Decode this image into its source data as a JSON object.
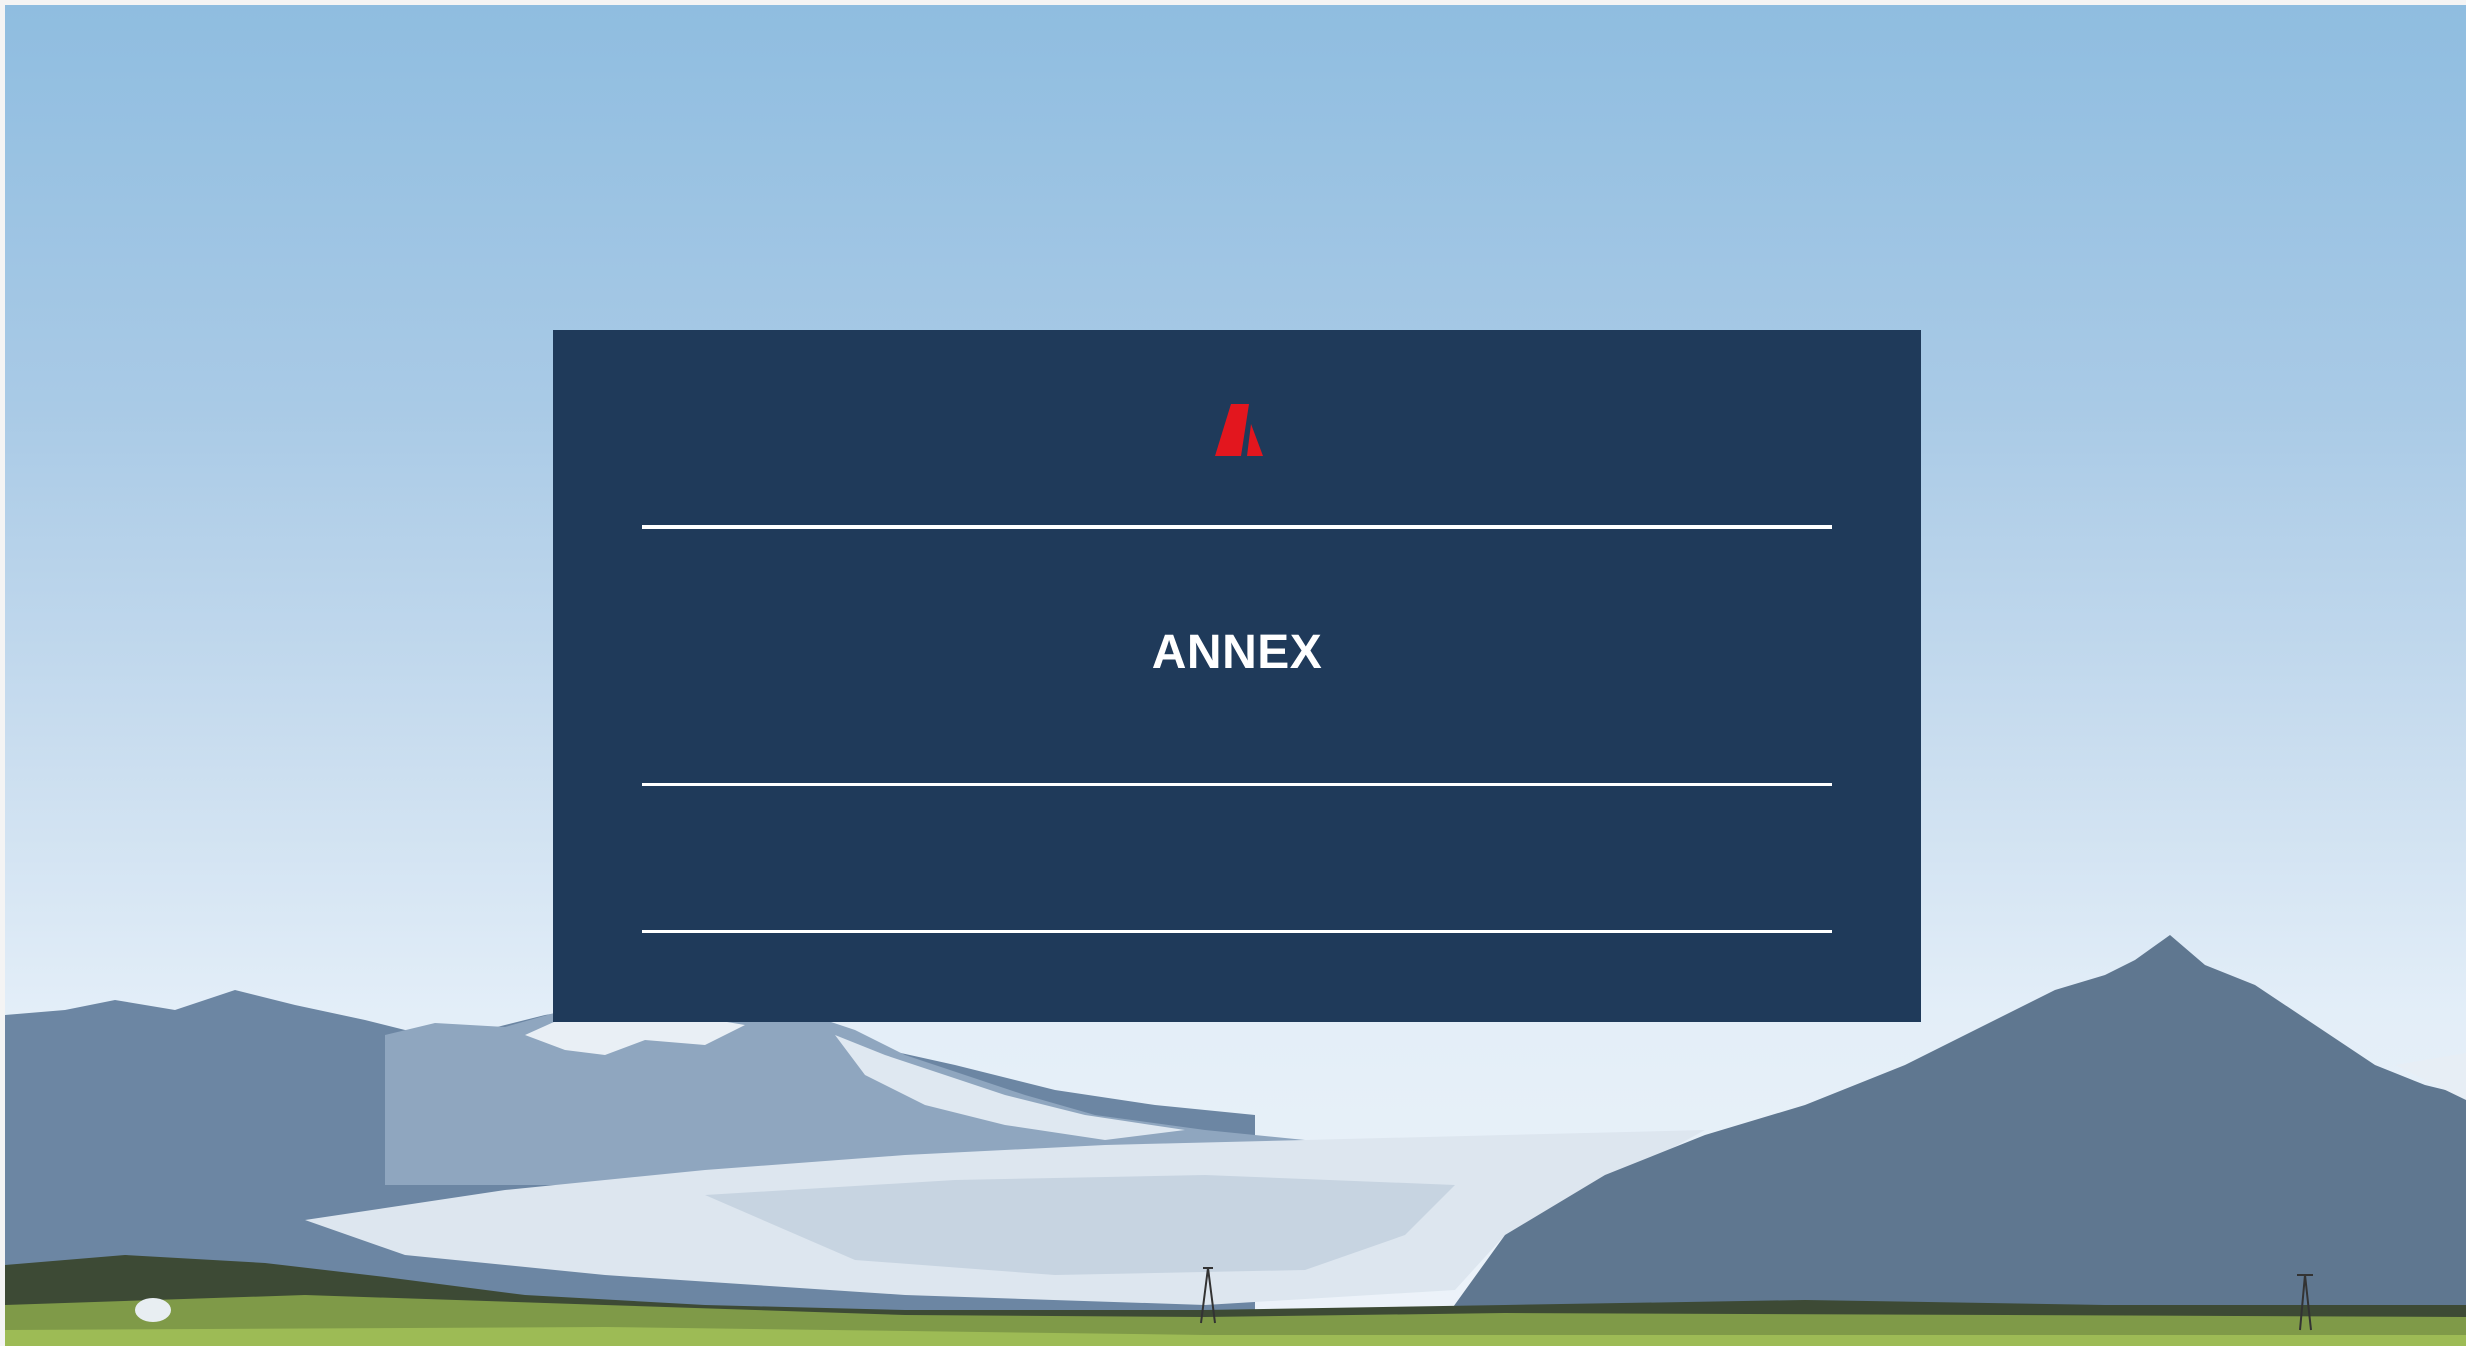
{
  "slide": {
    "title": "ANNEX"
  },
  "brand": {
    "logo_icon": "red-slanted-a-mark-icon",
    "accent": "#e3161e",
    "panel_color": "#1f3a5a"
  }
}
